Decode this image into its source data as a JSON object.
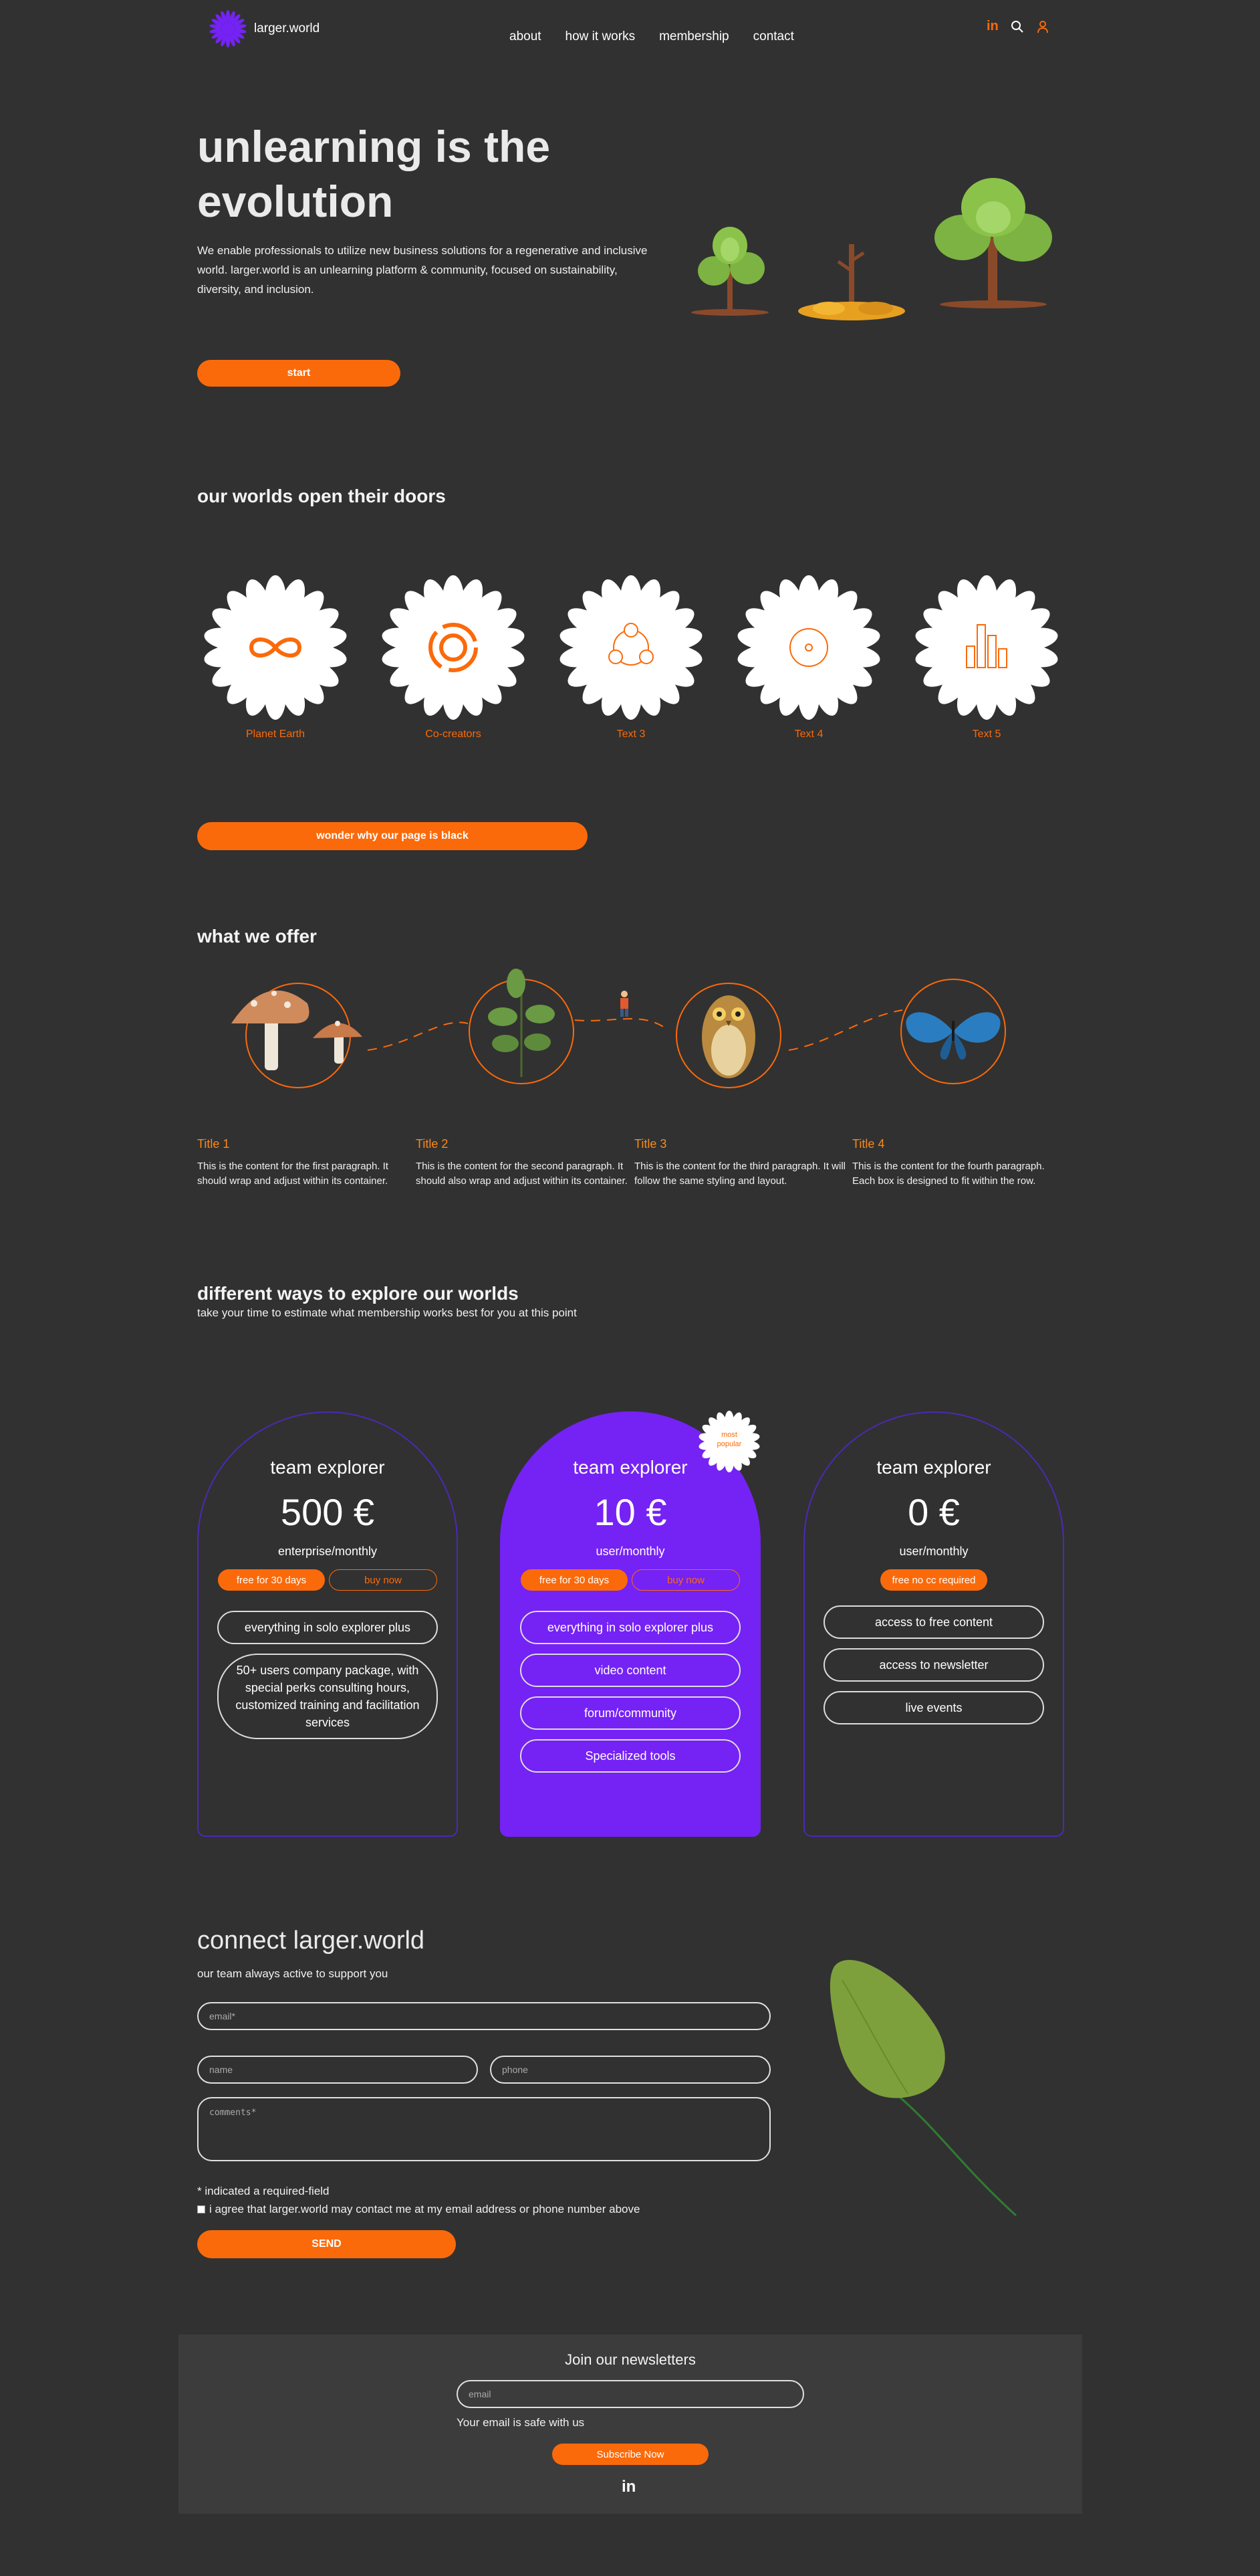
{
  "header": {
    "logo_text": "larger.world",
    "nav": [
      "about",
      "how it works",
      "membership",
      "contact"
    ],
    "icons": [
      "linkedin-icon",
      "search-icon",
      "user-icon"
    ]
  },
  "hero": {
    "title_line1": "unlearning is the",
    "title_line2": "evolution",
    "text": "We enable professionals to utilize new business solutions for a regenerative and inclusive world. larger.world is an unlearning platform & community, focused on sustainability, diversity, and inclusion.",
    "cta": "start"
  },
  "worlds": {
    "title": "our worlds open their doors",
    "items": [
      {
        "label": "Planet Earth",
        "icon": "infinity-icon"
      },
      {
        "label": "Co-creators",
        "icon": "circles-icon"
      },
      {
        "label": "Text 3",
        "icon": "triad-icon"
      },
      {
        "label": "Text 4",
        "icon": "target-icon"
      },
      {
        "label": "Text 5",
        "icon": "bars-icon"
      }
    ],
    "cta": "wonder why our page is black"
  },
  "offer": {
    "title": "what we offer",
    "items": [
      {
        "title": "Title 1",
        "text": "This is the content for the first paragraph. It should wrap and adjust within its container."
      },
      {
        "title": "Title 2",
        "text": "This is the content for the second paragraph. It should also wrap and adjust within its container."
      },
      {
        "title": "Title 3",
        "text": "This is the content for the third paragraph. It will follow the same styling and layout."
      },
      {
        "title": "Title 4",
        "text": "This is the content for the fourth paragraph. Each box is designed to fit within the row."
      }
    ]
  },
  "pricing": {
    "title": "different ways to explore our worlds",
    "subtitle": "take your time to estimate what membership works best for you at this point",
    "cards": [
      {
        "name": "team explorer",
        "price": "500 €",
        "period": "enterprise/monthly",
        "pill_fill": "free for 30 days",
        "pill_out": "buy now",
        "features": [
          "everything in solo explorer plus",
          "50+ users company package, with special perks consulting hours, customized training and facilitation services"
        ]
      },
      {
        "name": "team explorer",
        "price": "10 €",
        "period": "user/monthly",
        "pill_fill": "free for 30 days",
        "pill_out": "buy now",
        "badge": "most popular",
        "features": [
          "everything in solo explorer plus",
          "video content",
          "forum/community",
          "Specialized tools"
        ]
      },
      {
        "name": "team explorer",
        "price": "0 €",
        "period": "user/monthly",
        "pill_fill": "free no cc required",
        "features": [
          "access to free content",
          "access to newsletter",
          "live events"
        ]
      }
    ]
  },
  "contact": {
    "title": "connect larger.world",
    "subtitle": "our team always active to support you",
    "email_placeholder": "email*",
    "name_placeholder": "name",
    "phone_placeholder": "phone",
    "comments_placeholder": "comments*",
    "required_note": "* indicated a required-field",
    "consent": "i agree that larger.world may contact me at my email address or phone number above",
    "send": "SEND"
  },
  "newsletter": {
    "title": "Join our newsletters",
    "email_placeholder": "email",
    "safe_note": "Your email is safe with us",
    "button": "Subscribe Now"
  },
  "colors": {
    "accent": "#fb6a0a",
    "purple": "#7522f5",
    "background": "#313131"
  }
}
